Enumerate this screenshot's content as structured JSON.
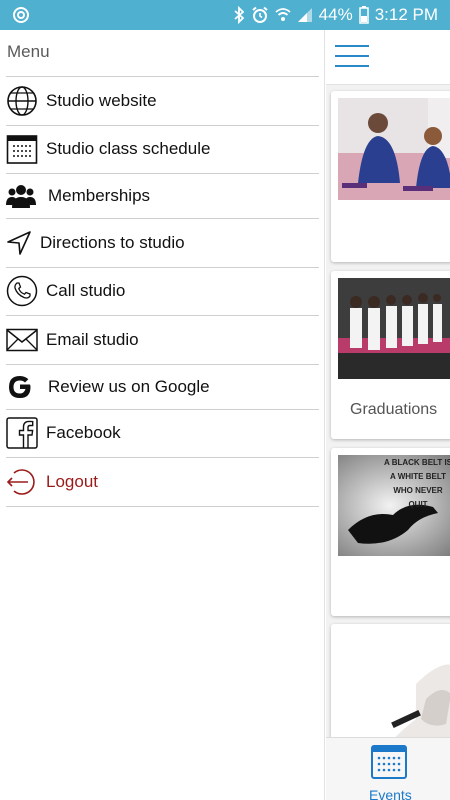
{
  "status_bar": {
    "battery": "44%",
    "time": "3:12 PM"
  },
  "drawer": {
    "title": "Menu",
    "items": [
      {
        "label": "Studio website",
        "icon": "globe-icon"
      },
      {
        "label": "Studio class schedule",
        "icon": "calendar-icon"
      },
      {
        "label": "Memberships",
        "icon": "people-icon"
      },
      {
        "label": "Directions to studio",
        "icon": "navigation-arrow-icon"
      },
      {
        "label": "Call studio",
        "icon": "phone-icon"
      },
      {
        "label": "Email studio",
        "icon": "envelope-icon"
      },
      {
        "label": "Review us on Google",
        "icon": "google-icon"
      },
      {
        "label": "Facebook",
        "icon": "facebook-icon"
      },
      {
        "label": "Logout",
        "icon": "logout-icon"
      }
    ]
  },
  "main": {
    "cards": [
      {
        "title": ""
      },
      {
        "title": "Graduations"
      },
      {
        "title": "",
        "image_text": "A BLACK BELT IS A WHITE BELT WHO NEVER QUIT"
      },
      {
        "title": ""
      }
    ],
    "bottom_tab": {
      "label": "Events",
      "icon": "calendar-icon"
    }
  },
  "colors": {
    "status_bar": "#4fb0cf",
    "accent_blue": "#1c79c9",
    "logout_red": "#9b1b1b"
  }
}
